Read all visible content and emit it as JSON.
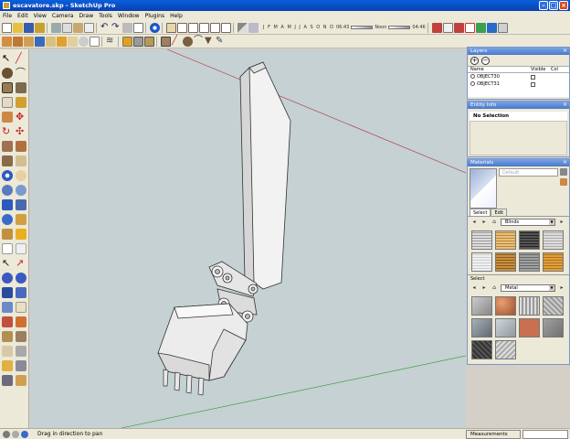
{
  "window": {
    "title": "escavatore.skp - SketchUp Pro"
  },
  "menu": [
    "File",
    "Edit",
    "View",
    "Camera",
    "Draw",
    "Tools",
    "Window",
    "Plugins",
    "Help"
  ],
  "shadow_toolbar": {
    "months": "J F M A M J J A S O N D",
    "time_start": "06:43",
    "mid_label": "Noon",
    "time_end": "04:46"
  },
  "toolbar_top_icons": [
    "new-icon",
    "open-icon",
    "save-icon",
    "make-component-icon",
    "cut-icon",
    "copy-icon",
    "paste-icon",
    "erase-icon",
    "undo-icon",
    "redo-icon",
    "print-icon",
    "model-info-icon",
    "orbit-icon",
    "iso-view-icon",
    "top-view-icon",
    "front-view-icon",
    "right-view-icon",
    "back-view-icon",
    "left-view-icon",
    "shadows-icon",
    "fog-icon"
  ],
  "toolbar_bottom_icons": [
    "sandbox-icon",
    "stamp-icon",
    "drape-icon",
    "smoove-icon",
    "add-detail-icon",
    "flip-edge-icon",
    "from-contours-icon",
    "from-scratch-icon",
    "xray-icon",
    "wireframe-icon",
    "hidden-line-icon",
    "shaded-icon",
    "shaded-texture-icon",
    "monochrome-icon",
    "select-icon",
    "make-component-icon",
    "paint-icon",
    "eraser-icon",
    "rectangle-icon",
    "line-icon",
    "circle-icon",
    "arc-icon",
    "polygon-icon",
    "freehand-icon"
  ],
  "layers": {
    "title": "Layers",
    "columns": [
      "Name",
      "Visible",
      "Col"
    ],
    "rows": [
      {
        "name": "OBJECT30"
      },
      {
        "name": "OBJECT31"
      }
    ]
  },
  "entity_info": {
    "title": "Entity Info",
    "selection": "No Selection"
  },
  "materials": {
    "title": "Materials",
    "current_name": "Default",
    "tabs": [
      "Select",
      "Edit"
    ],
    "top_collection": "Blinds",
    "bottom_label": "Select",
    "bottom_collection": "Metal"
  },
  "status": {
    "message": "Drag in direction to pan",
    "measurements_label": "Measurements"
  },
  "colors": {
    "title_bar": "#0a4fd0",
    "viewport_bg": "#c5d1d2",
    "panel_title": "#5a86d6"
  }
}
